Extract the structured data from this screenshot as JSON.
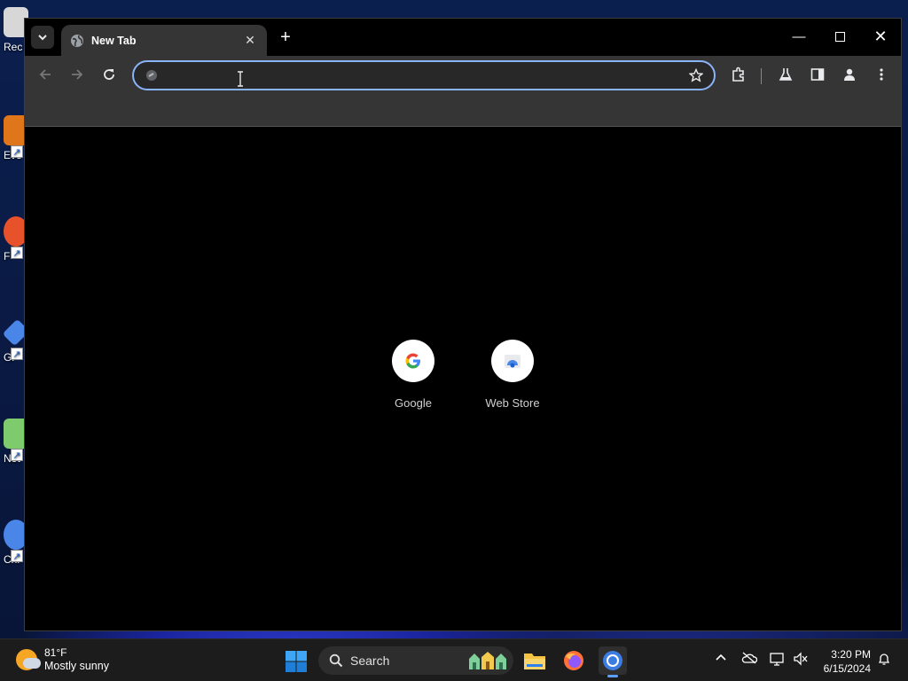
{
  "desktop": {
    "icons": [
      {
        "label": "Rec",
        "color": "#cfcfcf"
      },
      {
        "label": "Eve",
        "color": "#e0761a"
      },
      {
        "label": "F",
        "color": "#e8522a"
      },
      {
        "label": "Gi",
        "color": "#4a86e8"
      },
      {
        "label": "Not",
        "color": "#7ecb6e"
      },
      {
        "label": "Chr",
        "color": "#4a86e8"
      }
    ]
  },
  "browser": {
    "tab": {
      "title": "New Tab"
    },
    "omnibox": {
      "value": "",
      "placeholder": ""
    },
    "accent": "#8ab4f8",
    "shortcuts": [
      {
        "label": "Google",
        "icon": "google-g-icon"
      },
      {
        "label": "Web Store",
        "icon": "web-store-icon"
      }
    ]
  },
  "taskbar": {
    "weather": {
      "temp": "81°F",
      "condition": "Mostly sunny"
    },
    "search_label": "Search",
    "clock": {
      "time": "3:20 PM",
      "date": "6/15/2024"
    }
  }
}
